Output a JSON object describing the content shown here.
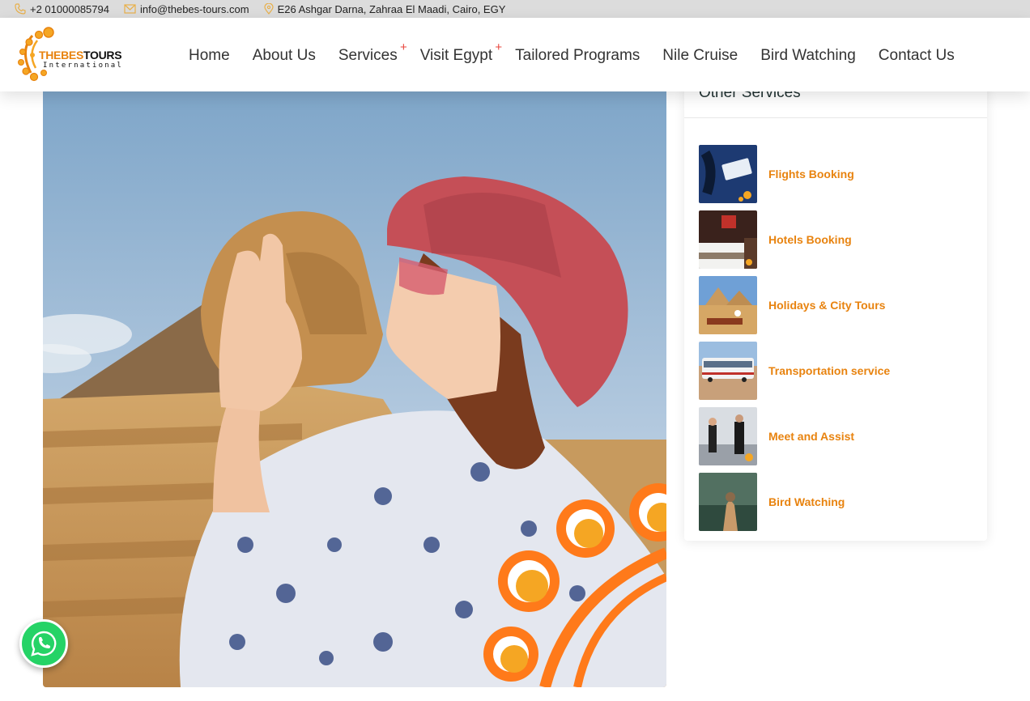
{
  "topbar": {
    "phone": "+2 01000085794",
    "email": "info@thebes-tours.com",
    "address": "E26 Ashgar Darna, Zahraa El Maadi, Cairo, EGY"
  },
  "logo": {
    "brand_part1": "THEBES",
    "brand_part2": "TOURS",
    "sub": "International"
  },
  "nav": {
    "items": [
      {
        "label": "Home"
      },
      {
        "label": "About Us"
      },
      {
        "label": "Services"
      },
      {
        "label": "Visit Egypt"
      },
      {
        "label": "Tailored Programs"
      },
      {
        "label": "Nile Cruise"
      },
      {
        "label": "Bird Watching"
      },
      {
        "label": "Contact Us"
      }
    ],
    "plus_marker": "+"
  },
  "sidebar": {
    "title": "Other Services",
    "services": [
      {
        "label": "Flights Booking",
        "icon": "flight-thumbnail"
      },
      {
        "label": "Hotels Booking",
        "icon": "hotel-thumbnail"
      },
      {
        "label": "Holidays & City Tours",
        "icon": "tour-thumbnail"
      },
      {
        "label": "Transportation service",
        "icon": "bus-thumbnail"
      },
      {
        "label": "Meet and Assist",
        "icon": "assist-thumbnail"
      },
      {
        "label": "Bird Watching",
        "icon": "bird-thumbnail"
      }
    ]
  },
  "colors": {
    "accent": "#e8830f",
    "topbar_bg": "#dcdcdc",
    "whatsapp": "#25d366",
    "plus": "#e8453c"
  }
}
